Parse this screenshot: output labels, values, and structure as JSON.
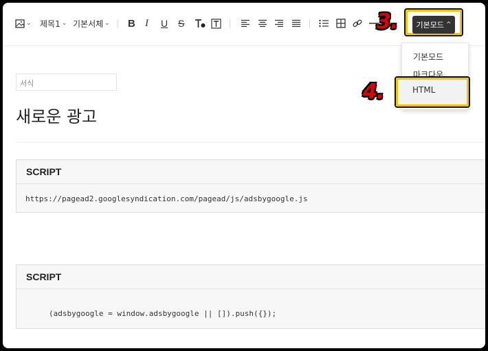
{
  "toolbar": {
    "heading_label": "제목1",
    "font_label": "기본서체",
    "mode_label": "기본모드"
  },
  "annotations": {
    "step3": "3.",
    "step4": "4."
  },
  "mode_menu": {
    "items": [
      "기본모드",
      "마크다운"
    ],
    "selected": "HTML"
  },
  "editor": {
    "format_placeholder": "서식",
    "title": "새로운 광고",
    "blocks": [
      {
        "label": "SCRIPT",
        "code": "https://pagead2.googlesyndication.com/pagead/js/adsbygoogle.js"
      },
      {
        "label": "SCRIPT",
        "code": "(adsbygoogle = window.adsbygoogle || []).push({});"
      }
    ]
  },
  "colors": {
    "highlight": "#f5c400",
    "annotation": "#e00000",
    "mode_button": "#333333"
  }
}
